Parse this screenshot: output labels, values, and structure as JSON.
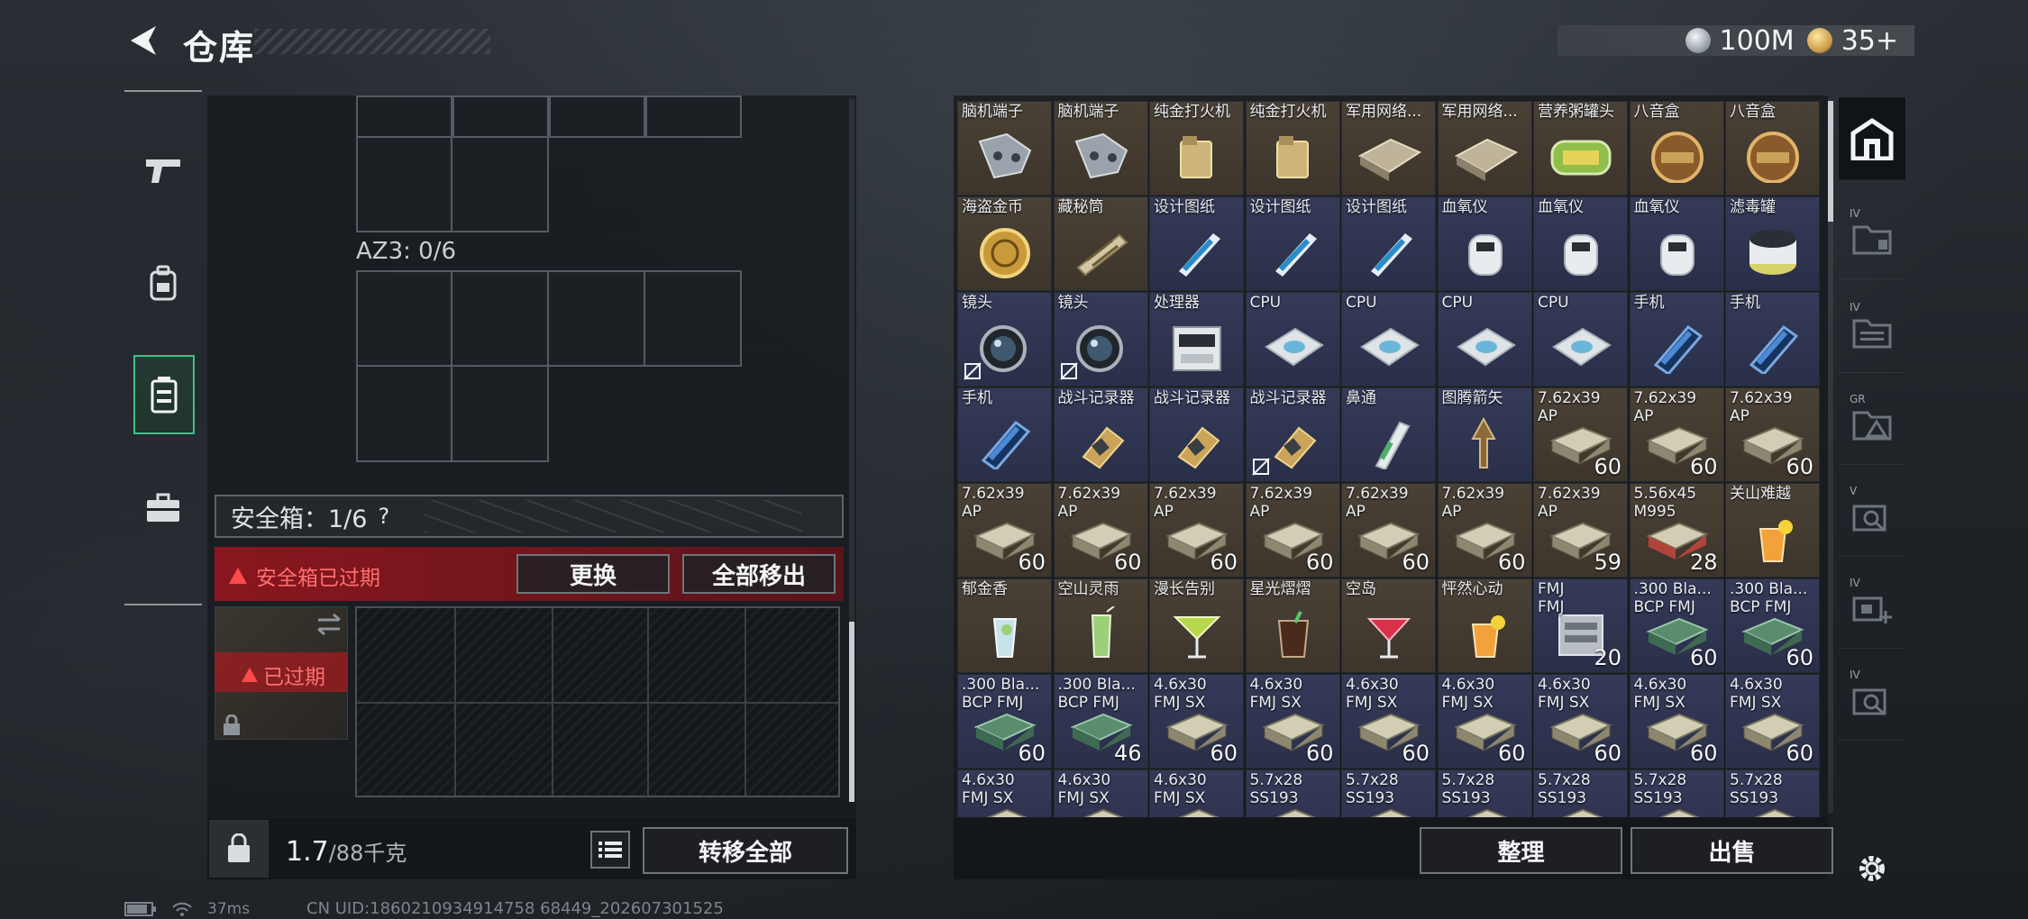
{
  "header": {
    "title": "仓库",
    "currency": [
      {
        "icon": "silver-coin-icon",
        "value": "100M"
      },
      {
        "icon": "gold-coin-icon",
        "value": "35+"
      }
    ]
  },
  "left_rail": {
    "items": [
      {
        "icon": "pistol-icon"
      },
      {
        "icon": "backpack-icon"
      },
      {
        "icon": "safebox-icon",
        "active": true
      },
      {
        "icon": "briefcase-icon"
      }
    ]
  },
  "container": {
    "az3_label": "AZ3: 0/6",
    "safebox_label": "安全箱：1/6",
    "help": "?",
    "expired_notice": "安全箱已过期",
    "replace_button": "更换",
    "remove_all_button": "全部移出",
    "thumb_expired": "已过期",
    "weight_value": "1.7",
    "weight_unit": "/88千克",
    "transfer_all_button": "转移全部"
  },
  "stash": {
    "sort_button": "整理",
    "sell_button": "出售",
    "rows": [
      [
        {
          "name": "脑机端子",
          "bg": "brown",
          "art": "chip"
        },
        {
          "name": "脑机端子",
          "bg": "brown",
          "art": "chip"
        },
        {
          "name": "纯金打火机",
          "bg": "brown",
          "art": "lighter"
        },
        {
          "name": "纯金打火机",
          "bg": "brown",
          "art": "lighter"
        },
        {
          "name": "军用网络...",
          "bg": "brown",
          "art": "module"
        },
        {
          "name": "军用网络...",
          "bg": "brown",
          "art": "module"
        },
        {
          "name": "营养粥罐头",
          "bg": "brown",
          "art": "can"
        },
        {
          "name": "八音盒",
          "bg": "brown",
          "art": "musicbox"
        },
        {
          "name": "八音盒",
          "bg": "brown",
          "art": "musicbox"
        }
      ],
      [
        {
          "name": "海盗金币",
          "bg": "brown",
          "art": "coin"
        },
        {
          "name": "藏秘筒",
          "bg": "brown",
          "art": "cryptex"
        },
        {
          "name": "设计图纸",
          "bg": "blue",
          "art": "blueprint"
        },
        {
          "name": "设计图纸",
          "bg": "blue",
          "art": "blueprint"
        },
        {
          "name": "设计图纸",
          "bg": "blue",
          "art": "blueprint"
        },
        {
          "name": "血氧仪",
          "bg": "blue",
          "art": "oximeter"
        },
        {
          "name": "血氧仪",
          "bg": "blue",
          "art": "oximeter"
        },
        {
          "name": "血氧仪",
          "bg": "blue",
          "art": "oximeter"
        },
        {
          "name": "滤毒罐",
          "bg": "blue",
          "art": "filter"
        }
      ],
      [
        {
          "name": "镜头",
          "bg": "blue",
          "art": "lens",
          "locked": true
        },
        {
          "name": "镜头",
          "bg": "blue",
          "art": "lens",
          "locked": true
        },
        {
          "name": "处理器",
          "bg": "blue",
          "art": "processor"
        },
        {
          "name": "CPU",
          "bg": "blue",
          "art": "cpu"
        },
        {
          "name": "CPU",
          "bg": "blue",
          "art": "cpu"
        },
        {
          "name": "CPU",
          "bg": "blue",
          "art": "cpu"
        },
        {
          "name": "CPU",
          "bg": "blue",
          "art": "cpu"
        },
        {
          "name": "手机",
          "bg": "blue",
          "art": "phone"
        },
        {
          "name": "手机",
          "bg": "blue",
          "art": "phone"
        }
      ],
      [
        {
          "name": "手机",
          "bg": "blue",
          "art": "phone"
        },
        {
          "name": "战斗记录器",
          "bg": "blue",
          "art": "recorder"
        },
        {
          "name": "战斗记录器",
          "bg": "blue",
          "art": "recorder"
        },
        {
          "name": "战斗记录器",
          "bg": "blue",
          "art": "recorder",
          "locked": true
        },
        {
          "name": "鼻通",
          "bg": "blue",
          "art": "inhaler"
        },
        {
          "name": "图腾箭矢",
          "bg": "blue",
          "art": "arrow"
        },
        {
          "name": "7.62x39",
          "name2": "AP",
          "bg": "brown",
          "art": "ammo",
          "count": "60"
        },
        {
          "name": "7.62x39",
          "name2": "AP",
          "bg": "brown",
          "art": "ammo",
          "count": "60"
        },
        {
          "name": "7.62x39",
          "name2": "AP",
          "bg": "brown",
          "art": "ammo",
          "count": "60"
        }
      ],
      [
        {
          "name": "7.62x39",
          "name2": "AP",
          "bg": "brown",
          "art": "ammo",
          "count": "60"
        },
        {
          "name": "7.62x39",
          "name2": "AP",
          "bg": "brown",
          "art": "ammo",
          "count": "60"
        },
        {
          "name": "7.62x39",
          "name2": "AP",
          "bg": "brown",
          "art": "ammo",
          "count": "60"
        },
        {
          "name": "7.62x39",
          "name2": "AP",
          "bg": "brown",
          "art": "ammo",
          "count": "60"
        },
        {
          "name": "7.62x39",
          "name2": "AP",
          "bg": "brown",
          "art": "ammo",
          "count": "60"
        },
        {
          "name": "7.62x39",
          "name2": "AP",
          "bg": "brown",
          "art": "ammo",
          "count": "60"
        },
        {
          "name": "7.62x39",
          "name2": "AP",
          "bg": "brown",
          "art": "ammo",
          "count": "59"
        },
        {
          "name": "5.56x45",
          "name2": "M995",
          "bg": "brown",
          "art": "ammo-red",
          "count": "28"
        },
        {
          "name": "关山难越",
          "bg": "brown",
          "art": "cocktail-orange"
        }
      ],
      [
        {
          "name": "郁金香",
          "bg": "brown",
          "art": "cocktail-clear"
        },
        {
          "name": "空山灵雨",
          "bg": "brown",
          "art": "cocktail-green"
        },
        {
          "name": "漫长告别",
          "bg": "brown",
          "art": "cocktail-lime"
        },
        {
          "name": "星光熠熠",
          "bg": "brown",
          "art": "cocktail-dark"
        },
        {
          "name": "空岛",
          "bg": "brown",
          "art": "cocktail-red"
        },
        {
          "name": "怦然心动",
          "bg": "brown",
          "art": "cocktail-orange"
        },
        {
          "name": "FMJ",
          "name2": "FMJ",
          "bg": "blue",
          "art": "ammo-grey",
          "count": "20"
        },
        {
          "name": ".300 Bla...",
          "name2": "BCP FMJ",
          "bg": "blue",
          "art": "ammo-green",
          "count": "60"
        },
        {
          "name": ".300 Bla...",
          "name2": "BCP FMJ",
          "bg": "blue",
          "art": "ammo-green",
          "count": "60"
        }
      ],
      [
        {
          "name": ".300 Bla...",
          "name2": "BCP FMJ",
          "bg": "blue",
          "art": "ammo-green",
          "count": "60"
        },
        {
          "name": ".300 Bla...",
          "name2": "BCP FMJ",
          "bg": "blue",
          "art": "ammo-green",
          "count": "46"
        },
        {
          "name": "4.6x30",
          "name2": "FMJ SX",
          "bg": "blue",
          "art": "ammo",
          "count": "60"
        },
        {
          "name": "4.6x30",
          "name2": "FMJ SX",
          "bg": "blue",
          "art": "ammo",
          "count": "60"
        },
        {
          "name": "4.6x30",
          "name2": "FMJ SX",
          "bg": "blue",
          "art": "ammo",
          "count": "60"
        },
        {
          "name": "4.6x30",
          "name2": "FMJ SX",
          "bg": "blue",
          "art": "ammo",
          "count": "60"
        },
        {
          "name": "4.6x30",
          "name2": "FMJ SX",
          "bg": "blue",
          "art": "ammo",
          "count": "60"
        },
        {
          "name": "4.6x30",
          "name2": "FMJ SX",
          "bg": "blue",
          "art": "ammo",
          "count": "60"
        },
        {
          "name": "4.6x30",
          "name2": "FMJ SX",
          "bg": "blue",
          "art": "ammo",
          "count": "60"
        }
      ],
      [
        {
          "name": "4.6x30",
          "name2": "FMJ SX",
          "bg": "blue",
          "art": "ammo"
        },
        {
          "name": "4.6x30",
          "name2": "FMJ SX",
          "bg": "blue",
          "art": "ammo"
        },
        {
          "name": "4.6x30",
          "name2": "FMJ SX",
          "bg": "blue",
          "art": "ammo"
        },
        {
          "name": "5.7x28",
          "name2": "SS193",
          "bg": "blue",
          "art": "ammo"
        },
        {
          "name": "5.7x28",
          "name2": "SS193",
          "bg": "blue",
          "art": "ammo"
        },
        {
          "name": "5.7x28",
          "name2": "SS193",
          "bg": "blue",
          "art": "ammo"
        },
        {
          "name": "5.7x28",
          "name2": "SS193",
          "bg": "blue",
          "art": "ammo"
        },
        {
          "name": "5.7x28",
          "name2": "SS193",
          "bg": "blue",
          "art": "ammo"
        },
        {
          "name": "5.7x28",
          "name2": "SS193",
          "bg": "blue",
          "art": "ammo"
        }
      ]
    ]
  },
  "tool_rail": {
    "items": [
      {
        "icon": "stash-tab-icon",
        "active": true
      },
      {
        "icon": "folder-iv-icon",
        "tag": "IV"
      },
      {
        "icon": "folder-iv-icon",
        "tag": "IV"
      },
      {
        "icon": "folder-triangle-icon",
        "tag": "GR"
      },
      {
        "icon": "box-search-icon",
        "tag": "V"
      },
      {
        "icon": "box-add-icon",
        "tag": "IV"
      },
      {
        "icon": "box-search-icon",
        "tag": "IV"
      },
      {
        "icon": "settings-gear-icon"
      }
    ]
  },
  "status": {
    "ping": "37ms",
    "uid": "CN UID:1860210934914758 68449_202607301525"
  },
  "colors": {
    "accent_green": "#3fbf8a",
    "warning_red": "#ff4a4a",
    "cell_brown": "#4a4136",
    "cell_blue": "#343a58"
  }
}
